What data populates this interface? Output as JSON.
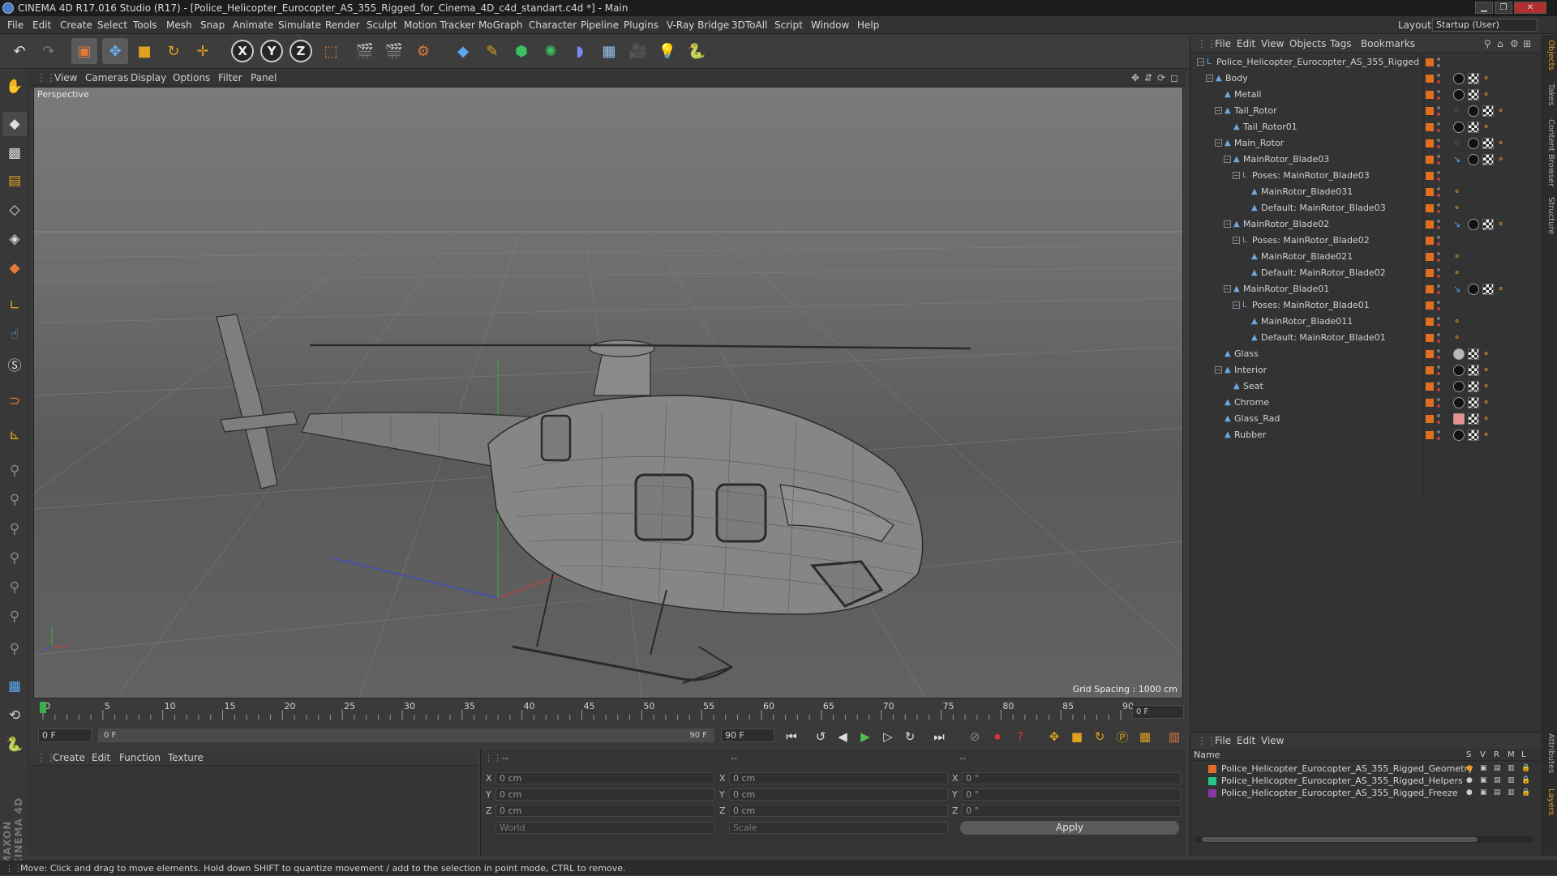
{
  "window": {
    "title": "CINEMA 4D R17.016 Studio (R17) - [Police_Helicopter_Eurocopter_AS_355_Rigged_for_Cinema_4D_c4d_standart.c4d *] - Main"
  },
  "menu": [
    "File",
    "Edit",
    "Create",
    "Select",
    "Tools",
    "Mesh",
    "Snap",
    "Animate",
    "Simulate",
    "Render",
    "Sculpt",
    "Motion Tracker",
    "MoGraph",
    "Character",
    "Pipeline",
    "Plugins",
    "V-Ray Bridge",
    "3DToAll",
    "Script",
    "Window",
    "Help"
  ],
  "layout": {
    "label": "Layout:",
    "value": "Startup (User)"
  },
  "toolbar": {
    "axis_x": "X",
    "axis_y": "Y",
    "axis_z": "Z"
  },
  "viewport_menu": [
    "View",
    "Cameras",
    "Display",
    "Options",
    "Filter",
    "Panel"
  ],
  "viewport": {
    "label": "Perspective",
    "grid_spacing": "Grid Spacing : 1000 cm"
  },
  "timeline": {
    "ticks": [
      "0",
      "5",
      "10",
      "15",
      "20",
      "25",
      "30",
      "35",
      "40",
      "45",
      "50",
      "55",
      "60",
      "65",
      "70",
      "75",
      "80",
      "85",
      "90"
    ],
    "frame_field": "0 F",
    "start_field": "0 F",
    "range_start": "0 F",
    "range_end": "90 F",
    "end_field": "90 F",
    "current_frame": 0
  },
  "material_menu": [
    "Create",
    "Edit",
    "Function",
    "Texture"
  ],
  "coords": {
    "headers": [
      "--",
      "--",
      "--"
    ],
    "rows": [
      {
        "axis": "X",
        "pos": "0 cm",
        "size_axis": "X",
        "size": "0 cm",
        "rot_axis": "X",
        "rot": "0 °"
      },
      {
        "axis": "Y",
        "pos": "0 cm",
        "size_axis": "Y",
        "size": "0 cm",
        "rot_axis": "Y",
        "rot": "0 °"
      },
      {
        "axis": "Z",
        "pos": "0 cm",
        "size_axis": "Z",
        "size": "0 cm",
        "rot_axis": "Z",
        "rot": "0 °"
      }
    ],
    "mode": "World",
    "scale_mode": "Scale",
    "apply": "Apply"
  },
  "objects_menu": [
    "File",
    "Edit",
    "View",
    "Objects",
    "Tags",
    "Bookmarks"
  ],
  "objects": [
    {
      "name": "Police_Helicopter_Eurocopter_AS_355_Rigged",
      "depth": 0,
      "exp": "−",
      "icon": "null",
      "tags": []
    },
    {
      "name": "Body",
      "depth": 1,
      "exp": "−",
      "icon": "bone",
      "tags": [
        "sphere",
        "check",
        "bone"
      ]
    },
    {
      "name": "Metall",
      "depth": 2,
      "exp": "",
      "icon": "bone",
      "tags": [
        "sphere",
        "check",
        "bone"
      ]
    },
    {
      "name": "Tail_Rotor",
      "depth": 2,
      "exp": "−",
      "icon": "bone",
      "tags": [
        "dots",
        "sphere",
        "check",
        "bone"
      ]
    },
    {
      "name": "Tail_Rotor01",
      "depth": 3,
      "exp": "",
      "icon": "bone",
      "tags": [
        "sphere",
        "check",
        "bone"
      ]
    },
    {
      "name": "Main_Rotor",
      "depth": 2,
      "exp": "−",
      "icon": "bone",
      "tags": [
        "dots",
        "sphere",
        "check",
        "bone"
      ]
    },
    {
      "name": "MainRotor_Blade03",
      "depth": 3,
      "exp": "−",
      "icon": "bone",
      "tags": [
        "ik",
        "sphere",
        "check",
        "bone"
      ]
    },
    {
      "name": "Poses: MainRotor_Blade03",
      "depth": 4,
      "exp": "−",
      "icon": "null",
      "tags": []
    },
    {
      "name": "MainRotor_Blade031",
      "depth": 5,
      "exp": "",
      "icon": "bone",
      "tags": [
        "bone"
      ]
    },
    {
      "name": "Default: MainRotor_Blade03",
      "depth": 5,
      "exp": "",
      "icon": "bone",
      "tags": [
        "bone"
      ]
    },
    {
      "name": "MainRotor_Blade02",
      "depth": 3,
      "exp": "−",
      "icon": "bone",
      "tags": [
        "ik",
        "sphere",
        "check",
        "bone"
      ]
    },
    {
      "name": "Poses: MainRotor_Blade02",
      "depth": 4,
      "exp": "−",
      "icon": "null",
      "tags": []
    },
    {
      "name": "MainRotor_Blade021",
      "depth": 5,
      "exp": "",
      "icon": "bone",
      "tags": [
        "bone"
      ]
    },
    {
      "name": "Default: MainRotor_Blade02",
      "depth": 5,
      "exp": "",
      "icon": "bone",
      "tags": [
        "bone"
      ]
    },
    {
      "name": "MainRotor_Blade01",
      "depth": 3,
      "exp": "−",
      "icon": "bone",
      "tags": [
        "ik",
        "sphere",
        "check",
        "bone"
      ]
    },
    {
      "name": "Poses: MainRotor_Blade01",
      "depth": 4,
      "exp": "−",
      "icon": "null",
      "tags": []
    },
    {
      "name": "MainRotor_Blade011",
      "depth": 5,
      "exp": "",
      "icon": "bone",
      "tags": [
        "bone"
      ]
    },
    {
      "name": "Default: MainRotor_Blade01",
      "depth": 5,
      "exp": "",
      "icon": "bone",
      "tags": [
        "bone"
      ]
    },
    {
      "name": "Glass",
      "depth": 2,
      "exp": "",
      "icon": "bone",
      "tags": [
        "glass",
        "check",
        "bone"
      ]
    },
    {
      "name": "Interior",
      "depth": 2,
      "exp": "−",
      "icon": "bone",
      "tags": [
        "sphere",
        "check",
        "bone"
      ]
    },
    {
      "name": "Seat",
      "depth": 3,
      "exp": "",
      "icon": "bone",
      "tags": [
        "sphere",
        "check",
        "bone"
      ]
    },
    {
      "name": "Chrome",
      "depth": 2,
      "exp": "",
      "icon": "bone",
      "tags": [
        "sphere",
        "check",
        "bone"
      ]
    },
    {
      "name": "Glass_Rad",
      "depth": 2,
      "exp": "",
      "icon": "bone",
      "tags": [
        "pink",
        "check",
        "bone"
      ]
    },
    {
      "name": "Rubber",
      "depth": 2,
      "exp": "",
      "icon": "bone",
      "tags": [
        "sphere",
        "check",
        "bone"
      ]
    }
  ],
  "layers_menu": [
    "File",
    "Edit",
    "View"
  ],
  "layers_header": {
    "name": "Name",
    "cols": [
      "S",
      "V",
      "R",
      "M",
      "L"
    ]
  },
  "layers": [
    {
      "name": "Police_Helicopter_Eurocopter_AS_355_Rigged_Geometry",
      "color": "#e06b2a"
    },
    {
      "name": "Police_Helicopter_Eurocopter_AS_355_Rigged_Helpers",
      "color": "#2ac48a"
    },
    {
      "name": "Police_Helicopter_Eurocopter_AS_355_Rigged_Freeze",
      "color": "#8a3aa8"
    }
  ],
  "side_tabs": [
    "Objects",
    "Takes",
    "Content Browser",
    "Structure",
    "Attributes",
    "Layers"
  ],
  "status": "Move: Click and drag to move elements. Hold down SHIFT to quantize movement / add to the selection in point mode, CTRL to remove.",
  "logo": "MAXON CINEMA 4D"
}
